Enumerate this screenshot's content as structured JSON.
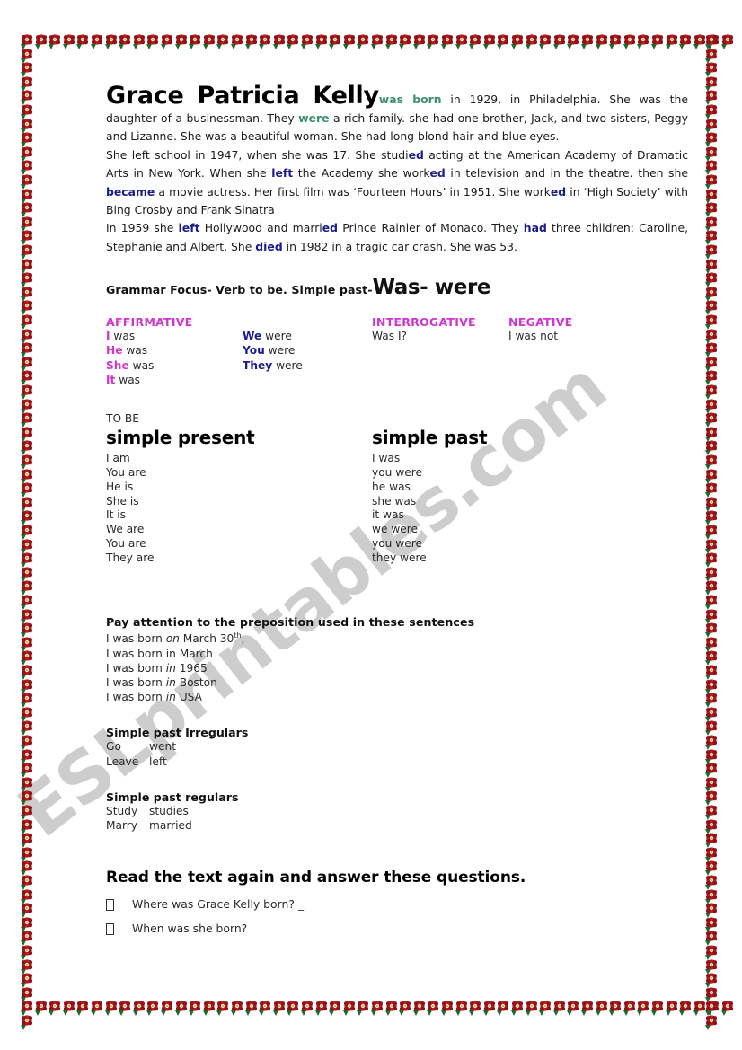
{
  "document": {
    "type": "esl-worksheet",
    "watermark": "ESLprintables.com",
    "border_motif": "rose-flower-border",
    "colors": {
      "green_highlight": "#3d8f6b",
      "blue_highlight": "#1b1b8e",
      "magenta_heading": "#cf35cf",
      "navy_pronoun": "#1b1b8e",
      "border_rose": "#b81c22",
      "border_leaf": "#1d6b2b",
      "watermark_gray": "#c9c9c9"
    }
  },
  "reading": {
    "name": "Grace Patricia Kelly",
    "p1": {
      "s1_green": "was born",
      "s1_rest": " in 1929, in Philadelphia. She was the daughter of a businessman. They ",
      "s2_green": "were",
      "s2_rest": " a rich family. she had one brother, Jack, and two sisters, Peggy and Lizanne. She was a beautiful woman. She had long blond hair and blue eyes."
    },
    "p2": {
      "a": "She left school in 1947, when she was 17. She studi",
      "b_blue": "ed",
      "c": " acting at the American Academy of Dramatic Arts in New York. When she ",
      "d_blue": "left",
      "e": " the Academy she work",
      "f_blue": "ed",
      "g": " in television and in the theatre. then she ",
      "h_blue": "became",
      "i": " a movie actress. Her first film was ‘Fourteen Hours’ in 1951. She work",
      "j_blue": "ed",
      "k": " in ‘High Society’ with Bing Crosby and Frank Sinatra"
    },
    "p3": {
      "a": "In 1959 she ",
      "b_blue": "left",
      "c": " Hollywood and marri",
      "d_blue": "ed",
      "e": " Prince Rainier of Monaco. They ",
      "f_blue": "had",
      "g": " three children: Caroline, Stephanie and Albert. She ",
      "h_blue": "died",
      "i": " in 1982 in a tragic car crash. She was 53."
    }
  },
  "grammar_focus": {
    "label": "Grammar Focus- Verb to be. Simple past-",
    "big": "Was- were"
  },
  "table": {
    "headers": {
      "affirmative": "AFFIRMATIVE",
      "interrogative": "INTERROGATIVE",
      "negative": "NEGATIVE"
    },
    "affirmative_col1": [
      {
        "pronoun": "I",
        "verb": " was"
      },
      {
        "pronoun": "He",
        "verb": " was"
      },
      {
        "pronoun": "She",
        "verb": " was"
      },
      {
        "pronoun": "It",
        "verb": " was"
      }
    ],
    "affirmative_col2": [
      {
        "pronoun": "We",
        "verb": " were"
      },
      {
        "pronoun": "You",
        "verb": " were"
      },
      {
        "pronoun": "They",
        "verb": " were"
      }
    ],
    "interrogative_rows": [
      "Was I?"
    ],
    "negative_rows": [
      "I was not"
    ]
  },
  "to_be": {
    "label": "TO BE",
    "present": {
      "title": "simple present",
      "rows": [
        "I am",
        "You are",
        "He is",
        "She is",
        "It is",
        "We are",
        "You are",
        "They are"
      ]
    },
    "past": {
      "title": "simple past",
      "rows": [
        "I was",
        "you were",
        "he was",
        "she was",
        "it was",
        "we were",
        "you were",
        "they were"
      ]
    }
  },
  "prepositions": {
    "heading": "Pay attention to the preposition used in these sentences",
    "lines": [
      {
        "pre": "I was born ",
        "prep": "on",
        "post": " March 30",
        "sup": "th",
        "tail": ","
      },
      {
        "pre": "I was born ",
        "prep": "",
        "post": "in March",
        "sup": "",
        "tail": ""
      },
      {
        "pre": "I was born ",
        "prep": "in",
        "post": " 1965",
        "sup": "",
        "tail": ""
      },
      {
        "pre": "I was born ",
        "prep": "in",
        "post": " Boston",
        "sup": "",
        "tail": ""
      },
      {
        "pre": "I was born ",
        "prep": "in",
        "post": " USA",
        "sup": "",
        "tail": ""
      }
    ]
  },
  "irregulars": {
    "heading": "Simple past Irregulars",
    "rows": [
      {
        "base": "Go",
        "past": "went"
      },
      {
        "base": "Leave",
        "past": "left"
      }
    ]
  },
  "regulars": {
    "heading": "Simple past regulars",
    "rows": [
      {
        "base": "Study",
        "past": "studies"
      },
      {
        "base": "Marry",
        "past": "married"
      }
    ]
  },
  "questions": {
    "heading": "Read the text again and answer these questions.",
    "items": [
      "Where was Grace Kelly born?  _",
      "When was she born?"
    ]
  }
}
